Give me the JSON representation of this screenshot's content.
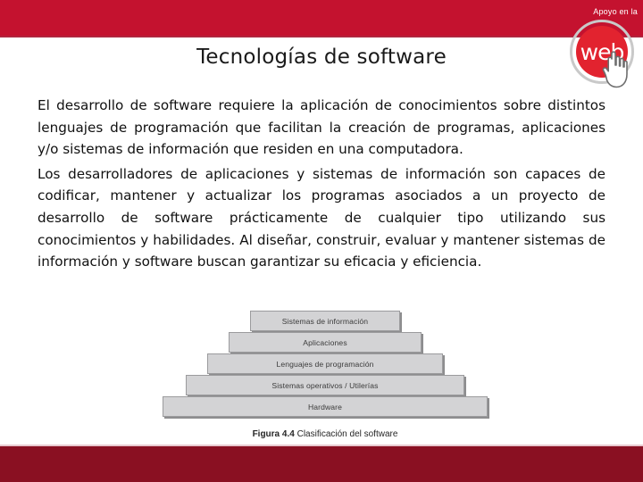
{
  "header": {
    "banner_color": "#c4122f",
    "logo": {
      "caption": "Apoyo en la",
      "word": "web",
      "ring_color": "#c9c9c9",
      "disc_color": "#e2232f",
      "cursor_icon": "pointing-hand-cursor-icon"
    }
  },
  "slide": {
    "title": "Tecnologías de software",
    "paragraphs": [
      "El desarrollo de software requiere la aplicación de conocimientos sobre distintos lenguajes de programación que facilitan la creación de programas, aplicaciones y/o sistemas de información que residen en una computadora.",
      "Los desarrolladores de aplicaciones y sistemas de información son capaces de codificar, mantener y actualizar los programas asociados a un proyecto de desarrollo de software prácticamente de cualquier tipo utilizando sus conocimientos y habilidades. Al diseñar, construir, evaluar y mantener sistemas de información y software buscan garantizar su eficacia y eficiencia."
    ]
  },
  "figure": {
    "caption_bold": "Figura 4.4",
    "caption_rest": " Clasificación del software",
    "layer_fill": "#d3d3d5",
    "layer_border": "#9b9b9d",
    "layers": [
      {
        "label": "Sistemas de información"
      },
      {
        "label": "Aplicaciones"
      },
      {
        "label": "Lenguajes de programación"
      },
      {
        "label": "Sistemas operativos /  Utilerías"
      },
      {
        "label": "Hardware"
      }
    ]
  },
  "footer": {
    "bar_color": "#8a1022"
  }
}
